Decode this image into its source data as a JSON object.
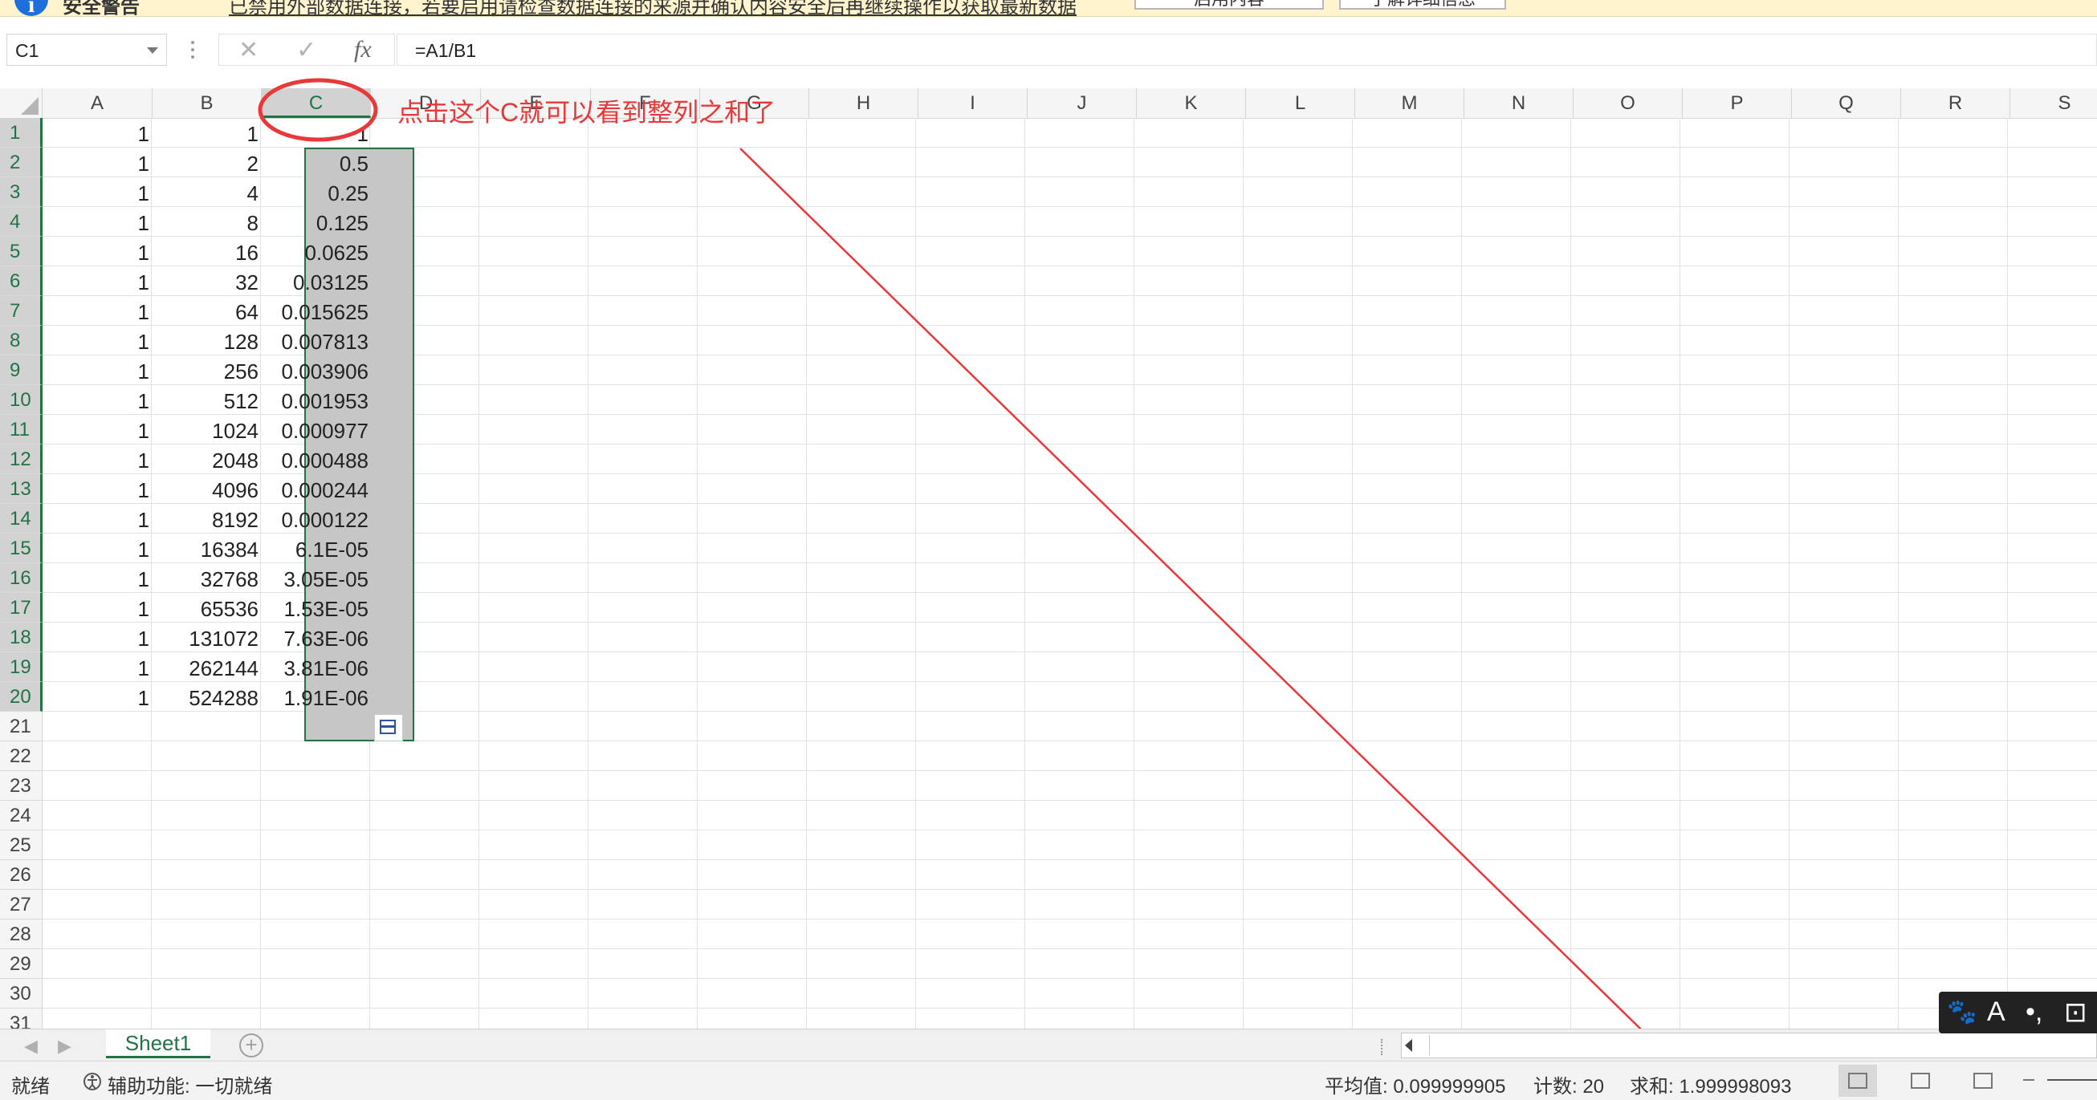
{
  "infobar": {
    "icon": "i",
    "title": "安全警告",
    "message": "已禁用外部数据连接，若要启用请检查数据连接的来源并确认内容安全后再继续操作以获取最新数据",
    "buttons": [
      "启用内容",
      "了解详细信息"
    ]
  },
  "formula_bar": {
    "name_box": "C1",
    "cancel_icon": "✕",
    "enter_icon": "✓",
    "fx_label": "fx",
    "formula": "=A1/B1"
  },
  "columns": [
    "A",
    "B",
    "C",
    "D",
    "E",
    "F",
    "G",
    "H",
    "I",
    "J",
    "K",
    "L",
    "M",
    "N",
    "O",
    "P",
    "Q",
    "R",
    "S"
  ],
  "selected_column": "C",
  "rows": [
    "1",
    "2",
    "3",
    "4",
    "5",
    "6",
    "7",
    "8",
    "9",
    "10",
    "11",
    "12",
    "13",
    "14",
    "15",
    "16",
    "17",
    "18",
    "19",
    "20",
    "21",
    "22",
    "23",
    "24",
    "25",
    "26",
    "27",
    "28",
    "29",
    "30",
    "31"
  ],
  "data": [
    [
      "1",
      "1",
      "1"
    ],
    [
      "1",
      "2",
      "0.5"
    ],
    [
      "1",
      "4",
      "0.25"
    ],
    [
      "1",
      "8",
      "0.125"
    ],
    [
      "1",
      "16",
      "0.0625"
    ],
    [
      "1",
      "32",
      "0.03125"
    ],
    [
      "1",
      "64",
      "0.015625"
    ],
    [
      "1",
      "128",
      "0.007813"
    ],
    [
      "1",
      "256",
      "0.003906"
    ],
    [
      "1",
      "512",
      "0.001953"
    ],
    [
      "1",
      "1024",
      "0.000977"
    ],
    [
      "1",
      "2048",
      "0.000488"
    ],
    [
      "1",
      "4096",
      "0.000244"
    ],
    [
      "1",
      "8192",
      "0.000122"
    ],
    [
      "1",
      "16384",
      "6.1E-05"
    ],
    [
      "1",
      "32768",
      "3.05E-05"
    ],
    [
      "1",
      "65536",
      "1.53E-05"
    ],
    [
      "1",
      "131072",
      "7.63E-06"
    ],
    [
      "1",
      "262144",
      "3.81E-06"
    ],
    [
      "1",
      "524288",
      "1.91E-06"
    ]
  ],
  "annotation": {
    "text": "点击这个C就可以看到整列之和了",
    "color": "#e8383a"
  },
  "sheet_tabs": {
    "nav_left": "◀",
    "nav_right": "▶",
    "active": "Sheet1",
    "add": "+"
  },
  "status_bar": {
    "ready": "就绪",
    "accessibility": "辅助功能: 一切就绪",
    "average": "平均值: 0.099999905",
    "count": "计数: 20",
    "sum": "求和: 1.999998093"
  },
  "ime_toolbar": {
    "items": [
      "🐾",
      "A",
      "•,",
      "⊡"
    ]
  },
  "colors": {
    "accent_green": "#217346",
    "selection_gray": "#c6c6c6",
    "annotation_red": "#e8383a",
    "infobar_bg": "#fff4ce"
  }
}
